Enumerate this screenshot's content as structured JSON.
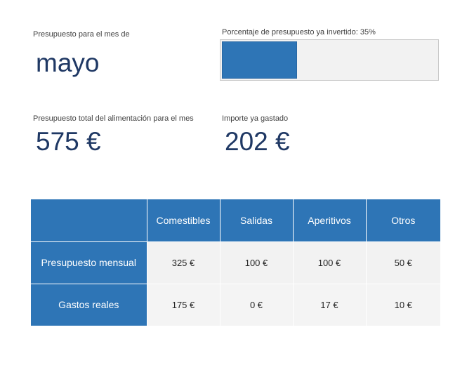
{
  "month": {
    "label": "Presupuesto para el mes de",
    "value": "mayo"
  },
  "progress": {
    "label": "Porcentaje de presupuesto ya invertido: 35%",
    "percent": 35,
    "fill_color": "#2e75b6"
  },
  "total_budget": {
    "label": "Presupuesto total del alimentación para el mes",
    "value": "575 €"
  },
  "spent": {
    "label": "Importe ya gastado",
    "value": "202 €"
  },
  "table": {
    "header_color": "#2e75b6",
    "columns": [
      "",
      "Comestibles",
      "Salidas",
      "Aperitivos",
      "Otros"
    ],
    "rows": [
      {
        "label": "Presupuesto mensual",
        "values": [
          "325 €",
          "100 €",
          "100 €",
          "50 €"
        ]
      },
      {
        "label": "Gastos reales",
        "values": [
          "175 €",
          "0 €",
          "17 €",
          "10 €"
        ]
      }
    ]
  }
}
